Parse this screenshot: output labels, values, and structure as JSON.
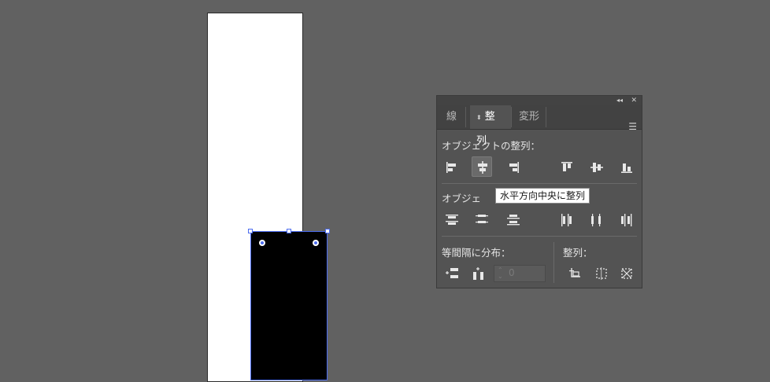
{
  "panel": {
    "tabs": [
      {
        "label": "線"
      },
      {
        "label": "整列"
      },
      {
        "label": "変形"
      }
    ],
    "sections": {
      "align_objects": "オブジェクトの整列：",
      "distribute_objects": "オブジェ",
      "distribute_spacing": "等間隔に分布：",
      "align_to": "整列："
    },
    "spacing_value": "0",
    "tooltip": "水平方向中央に整列"
  },
  "icons": {
    "collapse": "double-chevron-left-icon",
    "close": "close-icon",
    "menu": "hamburger-menu-icon",
    "tab_toggle": "up-down-arrow-icon"
  },
  "colors": {
    "selection": "#4b6cf0",
    "panel_bg": "#535353",
    "canvas_bg": "#616161"
  }
}
